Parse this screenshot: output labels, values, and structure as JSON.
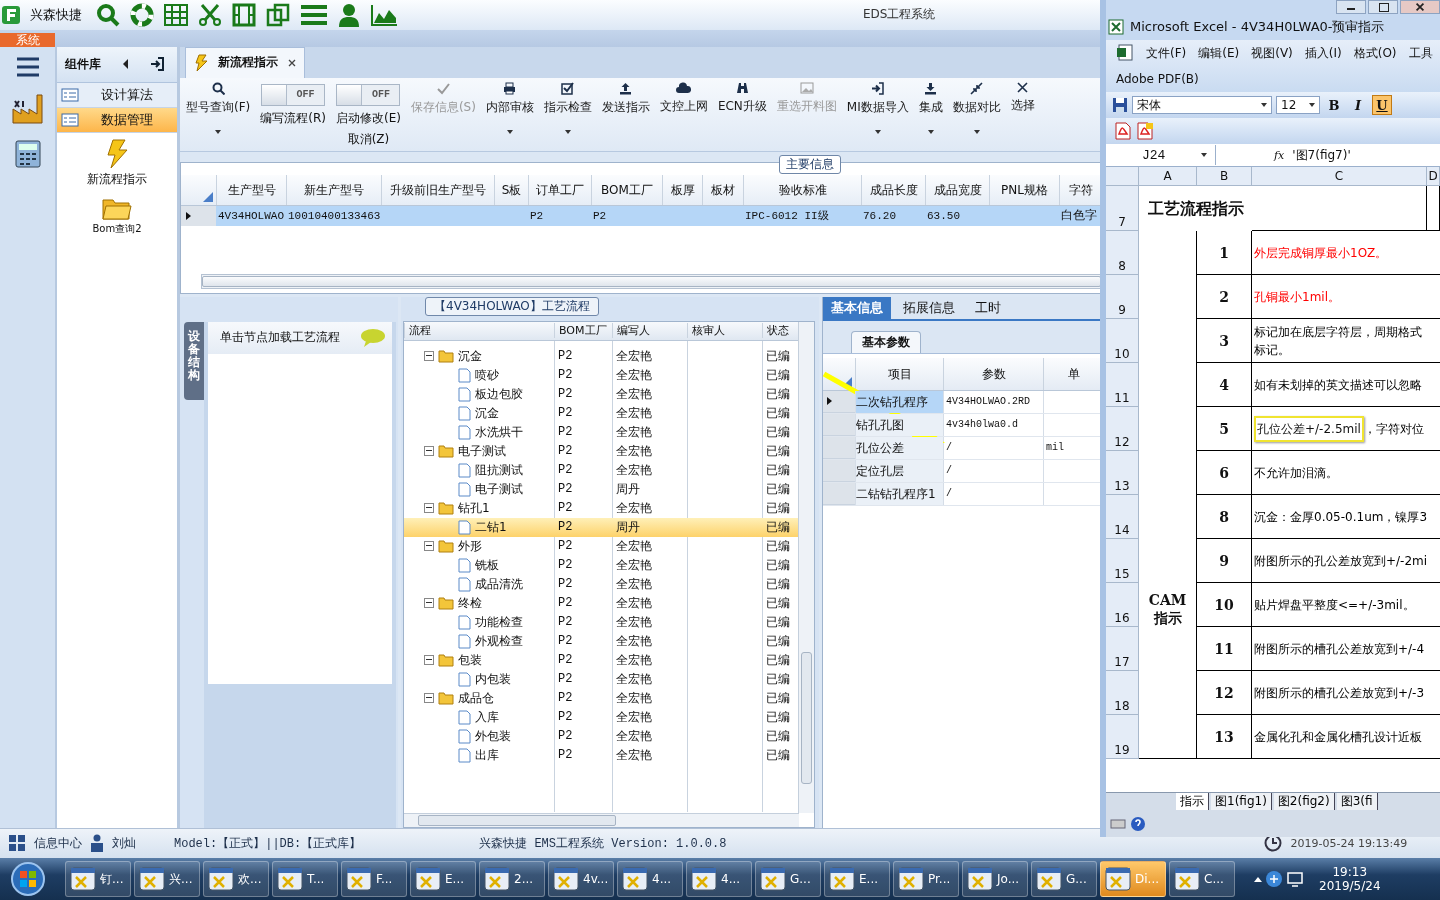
{
  "app": {
    "title": "兴森快捷",
    "window_title": "EDS工程系统",
    "menu_tab": "系统"
  },
  "components": {
    "title": "组件库",
    "items": [
      {
        "label": "设计算法",
        "selected": false
      },
      {
        "label": "数据管理",
        "selected": true
      }
    ],
    "tools": [
      {
        "label": "新流程指示"
      },
      {
        "label": "Bom查询2"
      }
    ]
  },
  "document_tab": {
    "label": "新流程指示"
  },
  "ribbon": [
    {
      "kind": "button",
      "label": "型号查询(F)",
      "dropdown": true,
      "disabled": false
    },
    {
      "kind": "toggle",
      "switch": "OFF",
      "on": false,
      "label": "编写流程(R)"
    },
    {
      "kind": "toggle",
      "switch": "OFF",
      "on": false,
      "label": "启动修改(E)",
      "label2": "取消(Z)"
    },
    {
      "kind": "button",
      "label": "保存信息(S)",
      "dropdown": false,
      "disabled": true
    },
    {
      "kind": "button",
      "label": "内部审核",
      "dropdown": true,
      "disabled": false
    },
    {
      "kind": "button",
      "label": "指示检查",
      "dropdown": true,
      "disabled": false
    },
    {
      "kind": "button",
      "label": "发送指示",
      "dropdown": false,
      "disabled": false
    },
    {
      "kind": "button",
      "label": "文控上网",
      "dropdown": false,
      "disabled": false
    },
    {
      "kind": "button",
      "label": "ECN升级",
      "dropdown": false,
      "disabled": false
    },
    {
      "kind": "button",
      "label": "重选开料图",
      "dropdown": false,
      "disabled": true
    },
    {
      "kind": "button",
      "label": "MI数据导入",
      "dropdown": true,
      "disabled": false
    },
    {
      "kind": "button",
      "label": "集成",
      "dropdown": true,
      "disabled": false
    },
    {
      "kind": "button",
      "label": "数据对比",
      "dropdown": true,
      "disabled": false
    },
    {
      "kind": "button",
      "label": "选择",
      "dropdown": false,
      "disabled": false
    }
  ],
  "main_info": {
    "title": "主要信息",
    "columns": [
      "生产型号",
      "新生产型号",
      "升级前旧生产型号",
      "S板",
      "订单工厂",
      "BOM工厂",
      "板厚",
      "板材",
      "验收标准",
      "成品长度",
      "成品宽度",
      "PNL规格",
      "字符"
    ],
    "rows": [
      {
        "selected": true,
        "cells": [
          "4V34HOLWAO",
          "10010400133463",
          null,
          null,
          "P2",
          "P2",
          null,
          null,
          "IPC-6012 II级",
          "76.20",
          "63.50",
          null,
          "白色字"
        ]
      }
    ]
  },
  "left_panel": {
    "tab": "设备结构",
    "hint": "单击节点加载工艺流程"
  },
  "tree": {
    "title": "【4V34HOLWAO】工艺流程",
    "columns": [
      "流程",
      "BOM工厂",
      "编写人",
      "核审人",
      "状态"
    ],
    "nodes": [
      {
        "name": "沉金",
        "bom": "P2",
        "writer": "全宏艳",
        "status": "已编",
        "expanded": true,
        "selected": false,
        "children": [
          {
            "name": "喷砂",
            "bom": "P2",
            "writer": "全宏艳",
            "status": "已编",
            "selected": false
          },
          {
            "name": "板边包胶",
            "bom": "P2",
            "writer": "全宏艳",
            "status": "已编",
            "selected": false
          },
          {
            "name": "沉金",
            "bom": "P2",
            "writer": "全宏艳",
            "status": "已编",
            "selected": false
          },
          {
            "name": "水洗烘干",
            "bom": "P2",
            "writer": "全宏艳",
            "status": "已编",
            "selected": false
          }
        ]
      },
      {
        "name": "电子测试",
        "bom": "P2",
        "writer": "全宏艳",
        "status": "已编",
        "expanded": true,
        "selected": false,
        "children": [
          {
            "name": "阻抗测试",
            "bom": "P2",
            "writer": "全宏艳",
            "status": "已编",
            "selected": false
          },
          {
            "name": "电子测试",
            "bom": "P2",
            "writer": "周丹",
            "status": "已编",
            "selected": false
          }
        ]
      },
      {
        "name": "钻孔1",
        "bom": "P2",
        "writer": "全宏艳",
        "status": "已编",
        "expanded": true,
        "selected": false,
        "children": [
          {
            "name": "二钻1",
            "bom": "P2",
            "writer": "周丹",
            "status": "已编",
            "selected": true
          }
        ]
      },
      {
        "name": "外形",
        "bom": "P2",
        "writer": "全宏艳",
        "status": "已编",
        "expanded": true,
        "selected": false,
        "children": [
          {
            "name": "铣板",
            "bom": "P2",
            "writer": "全宏艳",
            "status": "已编",
            "selected": false
          },
          {
            "name": "成品清洗",
            "bom": "P2",
            "writer": "全宏艳",
            "status": "已编",
            "selected": false
          }
        ]
      },
      {
        "name": "终检",
        "bom": "P2",
        "writer": "全宏艳",
        "status": "已编",
        "expanded": true,
        "selected": false,
        "children": [
          {
            "name": "功能检查",
            "bom": "P2",
            "writer": "全宏艳",
            "status": "已编",
            "selected": false
          },
          {
            "name": "外观检查",
            "bom": "P2",
            "writer": "全宏艳",
            "status": "已编",
            "selected": false
          }
        ]
      },
      {
        "name": "包装",
        "bom": "P2",
        "writer": "全宏艳",
        "status": "已编",
        "expanded": true,
        "selected": false,
        "children": [
          {
            "name": "内包装",
            "bom": "P2",
            "writer": "全宏艳",
            "status": "已编",
            "selected": false
          }
        ]
      },
      {
        "name": "成品仓",
        "bom": "P2",
        "writer": "全宏艳",
        "status": "已编",
        "expanded": true,
        "selected": false,
        "children": [
          {
            "name": "入库",
            "bom": "P2",
            "writer": "全宏艳",
            "status": "已编",
            "selected": false
          },
          {
            "name": "外包装",
            "bom": "P2",
            "writer": "全宏艳",
            "status": "已编",
            "selected": false
          },
          {
            "name": "出库",
            "bom": "P2",
            "writer": "全宏艳",
            "status": "已编",
            "selected": false
          }
        ]
      }
    ]
  },
  "detail": {
    "tabs": [
      {
        "label": "基本信息",
        "selected": true
      },
      {
        "label": "拓展信息",
        "selected": false
      },
      {
        "label": "工时",
        "selected": false
      }
    ],
    "subtab": "基本参数",
    "columns": [
      "项目",
      "参数",
      "单"
    ],
    "rows": [
      {
        "item": "二次钻孔程序",
        "value": "4V34HOLWAO.2RD",
        "selected": true
      },
      {
        "item": "钻孔孔图",
        "value": "4v34h0lwa0.d",
        "selected": false
      },
      {
        "item": "孔位公差",
        "value": "/",
        "unit": "mil",
        "selected": false
      },
      {
        "item": "定位孔层",
        "value": "/",
        "selected": false
      },
      {
        "item": "二钻钻孔程序1",
        "value": "/",
        "selected": false
      }
    ]
  },
  "status_bar": {
    "info": "信息中心",
    "user": "刘灿",
    "model": "Model:【正式】||DB:【正式库】",
    "product": "兴森快捷 EMS工程系统 Version: 1.0.0.8",
    "datetime": "2019-05-24 19:13:49"
  },
  "excel": {
    "title": "Microsoft Excel - 4V34H0LWA0-预审指示",
    "menu": [
      "文件(F)",
      "编辑(E)",
      "视图(V)",
      "插入(I)",
      "格式(O)",
      "工具"
    ],
    "menu2": "Adobe PDF(B)",
    "font": "宋体",
    "size": "12",
    "format_buttons": [
      {
        "label": "B",
        "on": false
      },
      {
        "label": "I",
        "on": false
      },
      {
        "label": "U",
        "on": true
      }
    ],
    "name_box": "J24",
    "fx": "fx",
    "formula": "'图7(fig7)'",
    "columns": [
      "A",
      "B",
      "C",
      "D"
    ],
    "title_row": {
      "row": "7",
      "text": "工艺流程指示"
    },
    "group_label": "CAM指示",
    "rows": [
      {
        "row": "8",
        "no": "1",
        "text": "外层完成铜厚最小1OZ。",
        "warning": true
      },
      {
        "row": "9",
        "no": "2",
        "text": "孔铜最小1mil。",
        "warning": true
      },
      {
        "row": "10",
        "no": "3",
        "text": "标记加在底层字符层，周期格式",
        "text2": "标记。",
        "warning": false
      },
      {
        "row": "11",
        "no": "4",
        "text": "如有未划掉的英文描述可以忽略",
        "warning": false
      },
      {
        "row": "12",
        "no": "5",
        "highlight": "孔位公差+/-2.5mil",
        "text": "，字符对位",
        "warning": false
      },
      {
        "row": "13",
        "no": "6",
        "text": "不允许加泪滴。",
        "warning": false
      },
      {
        "row": "14",
        "no": "8",
        "text": "沉金：金厚0.05-0.1um，镍厚3",
        "warning": false
      },
      {
        "row": "15",
        "no": "9",
        "text": "附图所示的孔公差放宽到+/-2mi",
        "warning": false
      },
      {
        "row": "16",
        "no": "10",
        "text": "贴片焊盘平整度<=+/-3mil。",
        "warning": false
      },
      {
        "row": "17",
        "no": "11",
        "text": "附图所示的槽孔公差放宽到+/-4",
        "warning": false
      },
      {
        "row": "18",
        "no": "12",
        "text": "附图所示的槽孔公差放宽到+/-3",
        "warning": false
      },
      {
        "row": "19",
        "no": "13",
        "text": "金属化孔和金属化槽孔设计近板",
        "warning": false
      }
    ],
    "sheets": [
      {
        "label": "指示",
        "selected": true
      },
      {
        "label": "图1(fig1)",
        "selected": false
      },
      {
        "label": "图2(fig2)",
        "selected": false
      },
      {
        "label": "图3(fi",
        "selected": false
      }
    ]
  },
  "taskbar": {
    "items": [
      {
        "label": "钉...",
        "active": false
      },
      {
        "label": "兴...",
        "active": false
      },
      {
        "label": "欢...",
        "active": false
      },
      {
        "label": "T...",
        "active": false
      },
      {
        "label": "F...",
        "active": false
      },
      {
        "label": "E...",
        "active": false
      },
      {
        "label": "2...",
        "active": false
      },
      {
        "label": "4v...",
        "active": false
      },
      {
        "label": "4...",
        "active": false
      },
      {
        "label": "4...",
        "active": false
      },
      {
        "label": "G...",
        "active": false
      },
      {
        "label": "E...",
        "active": false
      },
      {
        "label": "Pr...",
        "active": false
      },
      {
        "label": "Jo...",
        "active": false
      },
      {
        "label": "G...",
        "active": false
      },
      {
        "label": "Di...",
        "active": true
      },
      {
        "label": "C...",
        "active": false
      }
    ],
    "time": "19:13",
    "date": "2019/5/24"
  }
}
